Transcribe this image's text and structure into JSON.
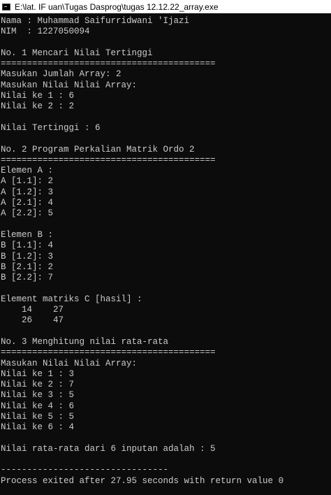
{
  "window": {
    "title": "E:\\lat. IF uan\\Tugas Dasprog\\tugas 12.12.22_array.exe",
    "icon": "console-app-icon"
  },
  "console": {
    "lines": [
      "Nama : Muhammad Saifurridwani 'Ijazi",
      "NIM  : 1227050094",
      "",
      "No. 1 Mencari Nilai Tertinggi",
      "=========================================",
      "Masukan Jumlah Array: 2",
      "Masukan Nilai Nilai Array:",
      "Nilai ke 1 : 6",
      "Nilai ke 2 : 2",
      "",
      "Nilai Tertinggi : 6",
      "",
      "No. 2 Program Perkalian Matrik Ordo 2",
      "=========================================",
      "Elemen A :",
      "A [1.1]: 2",
      "A [1.2]: 3",
      "A [2.1]: 4",
      "A [2.2]: 5",
      "",
      "Elemen B :",
      "B [1.1]: 4",
      "B [1.2]: 3",
      "B [2.1]: 2",
      "B [2.2]: 7",
      "",
      "Element matriks C [hasil] :",
      "    14    27",
      "    26    47",
      "",
      "No. 3 Menghitung nilai rata-rata",
      "=========================================",
      "Masukan Nilai Nilai Array:",
      "Nilai ke 1 : 3",
      "Nilai ke 2 : 7",
      "Nilai ke 3 : 5",
      "Nilai ke 4 : 6",
      "Nilai ke 5 : 5",
      "Nilai ke 6 : 4",
      "",
      "Nilai rata-rata dari 6 inputan adalah : 5",
      "",
      "--------------------------------",
      "Process exited after 27.95 seconds with return value 0"
    ]
  },
  "colors": {
    "background": "#0c0c0c",
    "text": "#cccccc",
    "titlebar": "#ffffff"
  }
}
